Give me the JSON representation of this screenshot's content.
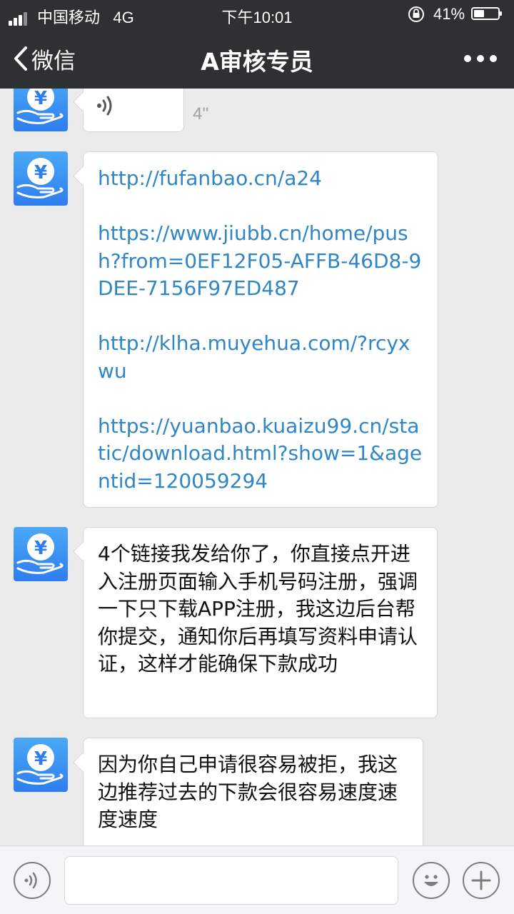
{
  "status_bar": {
    "carrier": "中国移动",
    "network": "4G",
    "time": "下午10:01",
    "battery": "41%"
  },
  "nav": {
    "back_label": "微信",
    "title": "A审核专员"
  },
  "messages": {
    "voice": {
      "duration": "4''"
    },
    "links": [
      "http://fufanbao.cn/a24",
      "https://www.jiubb.cn/home/push?from=0EF12F05-AFFB-46D8-9DEE-7156F97ED487",
      "http://klha.muyehua.com/?rcyxwu",
      "https://yuanbao.kuaizu99.cn/static/download.html?show=1&agentid=120059294"
    ],
    "text1": "4个链接我发给你了，你直接点开进入注册页面输入手机号码注册，强调一下只下载APP注册，我这边后台帮你提交，通知你后再填写资料申请认证，这样才能确保下款成功",
    "text2": "因为你自己申请很容易被拒，我这边推荐过去的下款会很容易速度速度速度"
  },
  "input_bar": {
    "placeholder": ""
  },
  "colors": {
    "header_bg": "#2e3132",
    "chat_bg": "#ebebeb",
    "link": "#2f86c7",
    "avatar": "#3b8ff2"
  },
  "icons": {
    "back": "chevron-left-icon",
    "more": "more-dots-icon",
    "voice": "voice-wave-icon",
    "emoji": "emoji-icon",
    "plus": "plus-icon",
    "lock": "orientation-lock-icon",
    "avatar": "yen-hand-icon"
  }
}
